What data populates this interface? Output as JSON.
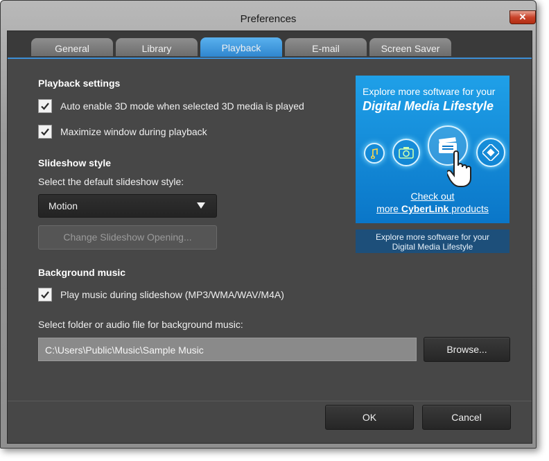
{
  "window": {
    "title": "Preferences",
    "close_glyph": "✕"
  },
  "tabs": [
    {
      "label": "General",
      "active": false
    },
    {
      "label": "Library",
      "active": false
    },
    {
      "label": "Playback",
      "active": true
    },
    {
      "label": "E-mail",
      "active": false
    },
    {
      "label": "Screen Saver",
      "active": false
    }
  ],
  "playback": {
    "heading": "Playback settings",
    "auto3d": {
      "label": "Auto enable 3D mode when selected 3D media is played",
      "checked": true
    },
    "maximize": {
      "label": "Maximize window during playback",
      "checked": true
    }
  },
  "slideshow": {
    "heading": "Slideshow style",
    "select_label": "Select the default slideshow style:",
    "style_value": "Motion",
    "change_opening_label": "Change Slideshow Opening..."
  },
  "music": {
    "heading": "Background music",
    "play_music": {
      "label": "Play music during slideshow (MP3/WMA/WAV/M4A)",
      "checked": true
    },
    "folder_label": "Select folder or audio file for background music:",
    "folder_value": "C:\\Users\\Public\\Music\\Sample Music",
    "browse_label": "Browse..."
  },
  "ad": {
    "line1": "Explore more software for your",
    "line2": "Digital Media Lifestyle",
    "icons": [
      "music-note-icon",
      "camera-icon",
      "clapperboard-icon",
      "film-reel-icon"
    ],
    "link_line1": "Check out",
    "link_line2_prefix": "more ",
    "link_line2_brand": "CyberLink",
    "link_line2_suffix": " products",
    "caption_line1": "Explore more software for your",
    "caption_line2": "Digital Media Lifestyle"
  },
  "footer": {
    "ok_label": "OK",
    "cancel_label": "Cancel"
  },
  "colors": {
    "accent": "#2f86cf",
    "panel": "#474747",
    "ad_blue": "#0a76c8"
  }
}
